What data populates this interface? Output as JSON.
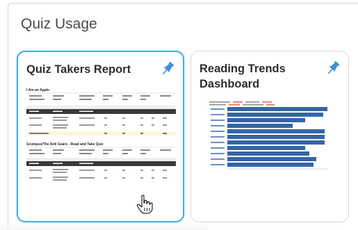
{
  "panel": {
    "title": "Quiz Usage"
  },
  "cards": [
    {
      "title": "Quiz Takers Report",
      "pin_icon": "pin-icon",
      "pin_color": "#3d8fd6",
      "thumbnail": {
        "section1_title": "I Am an Apple",
        "section2_title": "Grumpus/The Anti Gears - Read and Take Quiz"
      }
    },
    {
      "title": "Reading Trends Dashboard",
      "pin_icon": "pin-icon",
      "pin_color": "#3d8fd6",
      "thumbnail": {}
    }
  ],
  "colors": {
    "selected_border": "#45b0e1",
    "bar": "#3565a8",
    "table_header": "#3a3a3a"
  }
}
